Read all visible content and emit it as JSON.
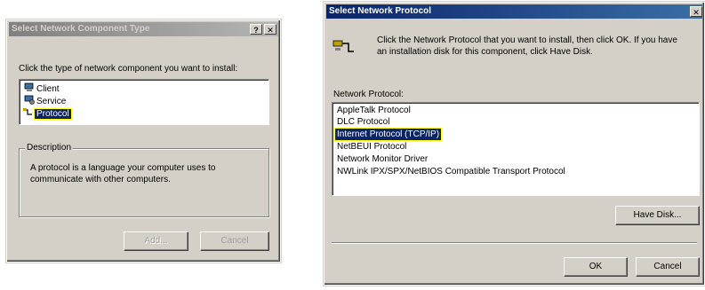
{
  "dialog_component": {
    "title": "Select Network Component Type",
    "help_button": "?",
    "close_button": "✕",
    "prompt": "Click the type of network component you want to install:",
    "items": [
      {
        "label": "Client",
        "icon": "client-icon"
      },
      {
        "label": "Service",
        "icon": "service-icon"
      },
      {
        "label": "Protocol",
        "icon": "protocol-icon"
      }
    ],
    "selected_index": 2,
    "description_legend": "Description",
    "description_text_line1": "A protocol is a language your computer uses to",
    "description_text_line2": "communicate with other computers.",
    "add_button": "Add...",
    "cancel_button": "Cancel"
  },
  "dialog_protocol": {
    "title": "Select Network Protocol",
    "close_button": "✕",
    "instructions_line1": "Click the Network Protocol that you want to install, then click OK. If you have",
    "instructions_line2": "an installation disk for this component, click Have Disk.",
    "list_label": "Network Protocol:",
    "protocols": [
      "AppleTalk Protocol",
      "DLC Protocol",
      "Internet Protocol (TCP/IP)",
      "NetBEUI Protocol",
      "Network Monitor Driver",
      "NWLink IPX/SPX/NetBIOS Compatible Transport Protocol"
    ],
    "selected_index": 2,
    "have_disk_button": "Have Disk...",
    "ok_button": "OK",
    "cancel_button": "Cancel"
  },
  "colors": {
    "face": "#d4d0c8",
    "selection": "#0a246a",
    "active_title": "#0a246a",
    "inactive_title": "#808080"
  }
}
